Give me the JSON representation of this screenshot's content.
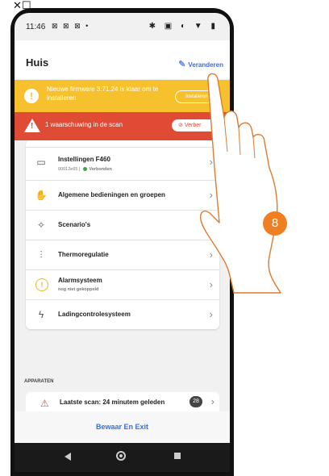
{
  "status_bar": {
    "time": "11:46",
    "notif_icons": "⊠ ⊠ ⊠ •",
    "right_icons": "✱ ▣ ◐ ▼ ▮"
  },
  "top_glyph": "✕☐",
  "header": {
    "title": "Huis",
    "edit_label": "Veranderen"
  },
  "firmware_banner": {
    "message": "Nieuwe firmware 3.71.24 is klaar om te installeren",
    "button_label": "Installeren"
  },
  "warning_banner": {
    "message": "1 waarschuwing in de scan",
    "button_label": "Verber"
  },
  "install_row": {
    "title": "Instellingen F460",
    "code": "00012e65",
    "separator": "|",
    "status": "Verbonden",
    "status_color": "#35a843"
  },
  "menu_items": [
    {
      "label": "Algemene bedieningen en groepen",
      "icon": "hand-icon",
      "glyph": "✋"
    },
    {
      "label": "Scenario's",
      "icon": "star-wand-icon",
      "glyph": "✧"
    },
    {
      "label": "Thermoregulatie",
      "icon": "thermometer-icon",
      "glyph": "⫶"
    },
    {
      "label": "Alarmsysteem",
      "sublabel": "nog niet gekoppeld",
      "icon": "alarm-warning-icon",
      "glyph": "!"
    },
    {
      "label": "Ladingcontrolesysteem",
      "icon": "lightning-icon",
      "glyph": "ϟ"
    }
  ],
  "devices_section": {
    "heading": "APPARATEN",
    "scan_label": "Laatste scan: 24 minutem geleden",
    "scan_count": "28"
  },
  "footer": {
    "save_label": "Bewaar En Exit"
  },
  "step_badge": "8",
  "colors": {
    "accent": "#3b6ed9",
    "firmware_banner": "#f6c12c",
    "warning_banner": "#e04b35",
    "step_badge": "#f07f22"
  }
}
